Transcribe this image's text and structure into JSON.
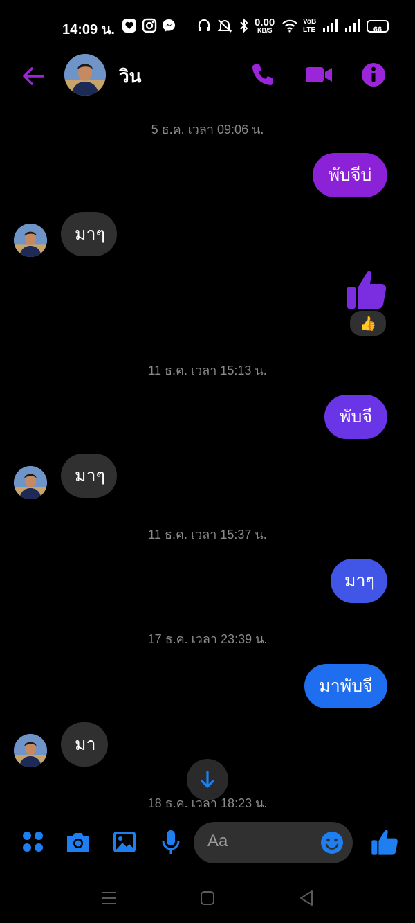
{
  "status_bar": {
    "time": "14:09 น.",
    "net_speed_value": "0.00",
    "net_speed_unit": "KB/S",
    "net_type_top": "VoB",
    "net_type_bottom": "LTE",
    "battery": "66",
    "icons": [
      "heart-app-icon",
      "instagram-icon",
      "messenger-icon",
      "headphones-icon",
      "mute-icon",
      "bluetooth-icon",
      "wifi-icon",
      "signal-icon",
      "signal-icon",
      "battery-icon"
    ]
  },
  "header": {
    "contact_name": "วิน",
    "icons": [
      "back-arrow-icon",
      "phone-icon",
      "video-camera-icon",
      "info-icon"
    ],
    "accent_color": "#9b26d9"
  },
  "messages": [
    {
      "type": "timestamp",
      "text": "5 ธ.ค. เวลา 09:06 น."
    },
    {
      "type": "outgoing",
      "text": "พับจีบ่",
      "color": "#8b22d8"
    },
    {
      "type": "incoming",
      "text": "มาๆ"
    },
    {
      "type": "outgoing-like",
      "reaction": "👍",
      "color": "#7a2ee0"
    },
    {
      "type": "timestamp",
      "text": "11 ธ.ค. เวลา 15:13 น."
    },
    {
      "type": "outgoing",
      "text": "พับจี",
      "color": "#6a35e6"
    },
    {
      "type": "incoming",
      "text": "มาๆ"
    },
    {
      "type": "timestamp",
      "text": "11 ธ.ค. เวลา 15:37 น."
    },
    {
      "type": "outgoing",
      "text": "มาๆ",
      "color": "#4156e6"
    },
    {
      "type": "timestamp",
      "text": "17 ธ.ค. เวลา 23:39 น."
    },
    {
      "type": "outgoing",
      "text": "มาพับจี",
      "color": "#1f6ef0"
    },
    {
      "type": "incoming",
      "text": "มา"
    },
    {
      "type": "timestamp",
      "text": "18 ธ.ค. เวลา 18:23 น."
    }
  ],
  "composer": {
    "placeholder": "Aa",
    "icons": [
      "apps-grid-icon",
      "camera-icon",
      "image-icon",
      "microphone-icon",
      "emoji-icon",
      "thumbs-up-icon"
    ],
    "accent_color": "#1f7ff0"
  },
  "scroll_down_icon": "arrow-down-icon",
  "system_nav": [
    "menu-icon",
    "home-square-icon",
    "back-triangle-icon"
  ]
}
